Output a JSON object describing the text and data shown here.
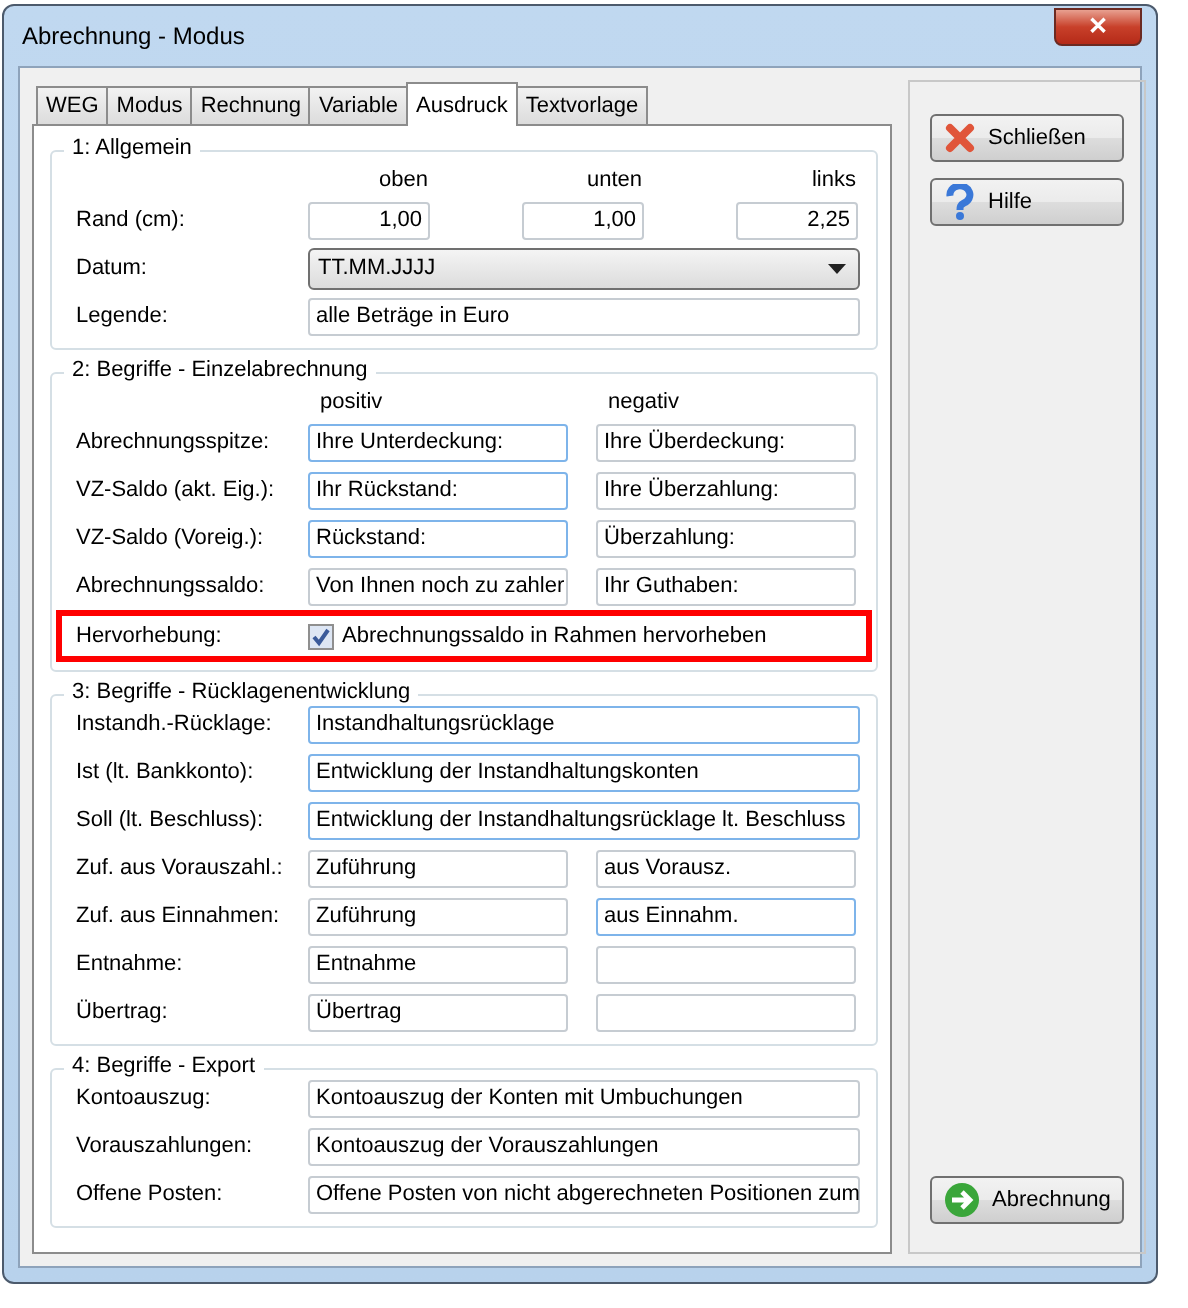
{
  "window": {
    "title": "Abrechnung - Modus",
    "close_glyph": "✕"
  },
  "tabs": [
    {
      "label": "WEG",
      "selected": false
    },
    {
      "label": "Modus",
      "selected": false
    },
    {
      "label": "Rechnung",
      "selected": false
    },
    {
      "label": "Variable",
      "selected": false
    },
    {
      "label": "Ausdruck",
      "selected": true
    },
    {
      "label": "Textvorlage",
      "selected": false
    }
  ],
  "sections": [
    {
      "title": "1: Allgemein",
      "rows": [
        {
          "kind": "header",
          "label": "",
          "columns": [
            "oben",
            "unten",
            "links"
          ]
        },
        {
          "kind": "triple",
          "label": "Rand (cm):",
          "fields": [
            {
              "value": "1,00",
              "highlighted": false
            },
            {
              "value": "1,00",
              "highlighted": false
            },
            {
              "value": "2,25",
              "highlighted": false
            }
          ]
        },
        {
          "kind": "select",
          "label": "Datum:",
          "value": "TT.MM.JJJJ"
        },
        {
          "kind": "text",
          "label": "Legende:",
          "fields": [
            {
              "value": "alle Beträge in Euro",
              "highlighted": false
            }
          ]
        }
      ]
    },
    {
      "title": "2: Begriffe - Einzelabrechnung",
      "rows": [
        {
          "kind": "header2",
          "label": "",
          "columns": [
            "positiv",
            "negativ"
          ]
        },
        {
          "kind": "pair",
          "label": "Abrechnungsspitze:",
          "fields": [
            {
              "value": "Ihre Unterdeckung:",
              "highlighted": true
            },
            {
              "value": "Ihre Überdeckung:",
              "highlighted": false
            }
          ]
        },
        {
          "kind": "pair",
          "label": "VZ-Saldo (akt. Eig.):",
          "fields": [
            {
              "value": "Ihr Rückstand:",
              "highlighted": true
            },
            {
              "value": "Ihre Überzahlung:",
              "highlighted": false
            }
          ]
        },
        {
          "kind": "pair",
          "label": "VZ-Saldo (Voreig.):",
          "fields": [
            {
              "value": "Rückstand:",
              "highlighted": true
            },
            {
              "value": "Überzahlung:",
              "highlighted": false
            }
          ]
        },
        {
          "kind": "pair",
          "label": "Abrechnungssaldo:",
          "fields": [
            {
              "value": "Von Ihnen noch zu zahler",
              "highlighted": false
            },
            {
              "value": "Ihr Guthaben:",
              "highlighted": false
            }
          ]
        },
        {
          "kind": "checkbox",
          "label": "Hervorhebung:",
          "text": "Abrechnungssaldo in Rahmen hervorheben",
          "checked": true,
          "framed": true
        }
      ]
    },
    {
      "title": "3: Begriffe - Rücklagenentwicklung",
      "rows": [
        {
          "kind": "text",
          "label": "Instandh.-Rücklage:",
          "fields": [
            {
              "value": "Instandhaltungsrücklage",
              "highlighted": true
            }
          ]
        },
        {
          "kind": "text",
          "label": "Ist (lt. Bankkonto):",
          "fields": [
            {
              "value": "Entwicklung der Instandhaltungskonten",
              "highlighted": true
            }
          ]
        },
        {
          "kind": "text",
          "label": "Soll (lt. Beschluss):",
          "fields": [
            {
              "value": "Entwicklung der Instandhaltungsrücklage lt. Beschluss",
              "highlighted": true
            }
          ]
        },
        {
          "kind": "pair",
          "label": "Zuf. aus Vorauszahl.:",
          "fields": [
            {
              "value": "Zuführung",
              "highlighted": false
            },
            {
              "value": "aus Vorausz.",
              "highlighted": false
            }
          ]
        },
        {
          "kind": "pair",
          "label": "Zuf. aus Einnahmen:",
          "fields": [
            {
              "value": "Zuführung",
              "highlighted": false
            },
            {
              "value": "aus Einnahm.",
              "highlighted": true
            }
          ]
        },
        {
          "kind": "pair",
          "label": "Entnahme:",
          "fields": [
            {
              "value": "Entnahme",
              "highlighted": false
            },
            {
              "highlighted": false
            }
          ]
        },
        {
          "kind": "pair",
          "label": "Übertrag:",
          "fields": [
            {
              "value": "Übertrag",
              "highlighted": false
            },
            {
              "highlighted": false
            }
          ]
        }
      ]
    },
    {
      "title": "4: Begriffe - Export",
      "rows": [
        {
          "kind": "text",
          "label": "Kontoauszug:",
          "fields": [
            {
              "value": "Kontoauszug der Konten mit Umbuchungen",
              "highlighted": false
            }
          ]
        },
        {
          "kind": "text",
          "label": "Vorauszahlungen:",
          "fields": [
            {
              "value": "Kontoauszug der Vorauszahlungen",
              "highlighted": false
            }
          ]
        },
        {
          "kind": "text",
          "label": "Offene Posten:",
          "fields": [
            {
              "value": "Offene Posten von nicht abgerechneten Positionen zum",
              "highlighted": false
            }
          ]
        }
      ]
    }
  ],
  "buttons": [
    {
      "kind": "close",
      "label": "Schließen"
    },
    {
      "kind": "help",
      "label": "Hilfe"
    },
    {
      "kind": "run",
      "label": "Abrechnung"
    }
  ]
}
